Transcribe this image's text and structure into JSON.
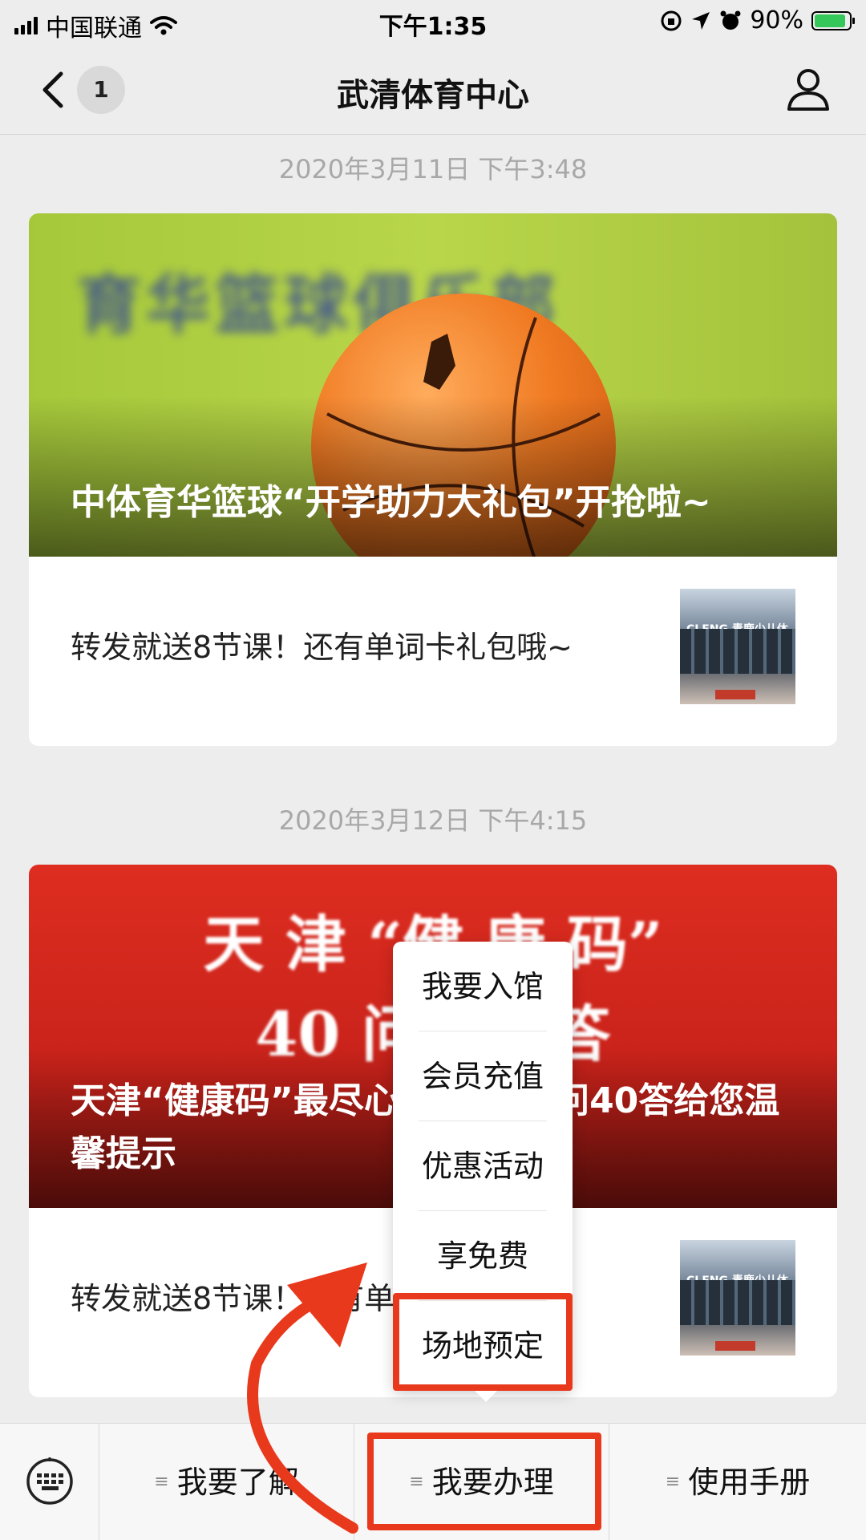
{
  "status_bar": {
    "carrier": "中国联通",
    "time": "下午1:35",
    "battery_percent": "90%"
  },
  "nav": {
    "back_icon": "chevron-left-icon",
    "unread_badge": "1",
    "title": "武清体育中心",
    "profile_icon": "user-icon"
  },
  "messages": [
    {
      "timestamp": "2020年3月11日 下午3:48",
      "cover_title": "中体育华篮球“开学助力大礼包”开抢啦~",
      "cover_sign": "育华篮球俱乐部",
      "description": "转发就送8节课！还有单词卡礼包哦~"
    },
    {
      "timestamp": "2020年3月12日 下午4:15",
      "cover_title": "天津“健康码”最尽心，送了40问40答给您温馨提示",
      "cover_headline_1": "天 津 “健 康 码”",
      "cover_headline_2": "40 问 40 答",
      "description": "转发就送8节课！还有单词卡礼包哦~"
    }
  ],
  "thumb_sign": "CLENG 青鹿少儿体适能",
  "popup_menu": {
    "items": [
      "我要入馆",
      "会员充值",
      "优惠活动",
      "享免费",
      "场地预定"
    ],
    "highlighted": "场地预定"
  },
  "bottom_menu": {
    "keyboard_icon": "keyboard-icon",
    "tabs": [
      "我要了解",
      "我要办理",
      "使用手册"
    ],
    "highlighted": "我要办理"
  },
  "colors": {
    "annotation": "#e8391c",
    "background": "#ededed",
    "battery": "#35c759"
  }
}
